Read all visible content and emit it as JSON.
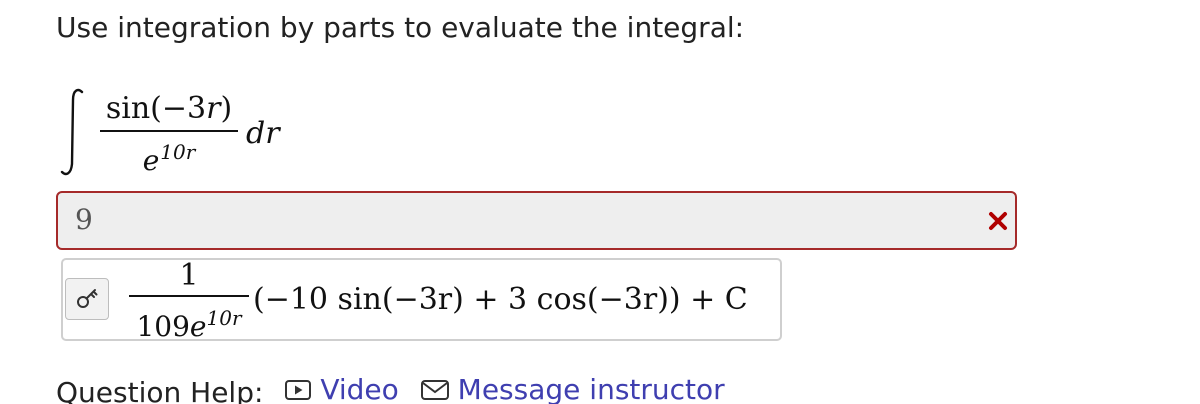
{
  "question": {
    "prompt": "Use integration by parts to evaluate the integral:",
    "integral": {
      "numerator_func": "sin",
      "numerator_arg": "(−3",
      "numerator_var": "r",
      "numerator_close": ")",
      "denominator_base": "e",
      "denominator_exp": "10r",
      "differential": "dr"
    }
  },
  "answer": {
    "value": "9",
    "status": "incorrect",
    "status_icon": "x-mark-icon",
    "status_color": "#b00000"
  },
  "preview": {
    "key_icon": "key-icon",
    "numerator": "1",
    "denominator_coeff": "109",
    "denominator_base": "e",
    "denominator_exp": "10r",
    "expression": "(−10 sin(−3r) + 3 cos(−3r)) + C"
  },
  "help": {
    "label": "Question Help:",
    "video_label": "Video",
    "message_label": "Message instructor",
    "video_icon": "video-play-icon",
    "message_icon": "envelope-icon",
    "link_color": "#3f3fb0"
  }
}
